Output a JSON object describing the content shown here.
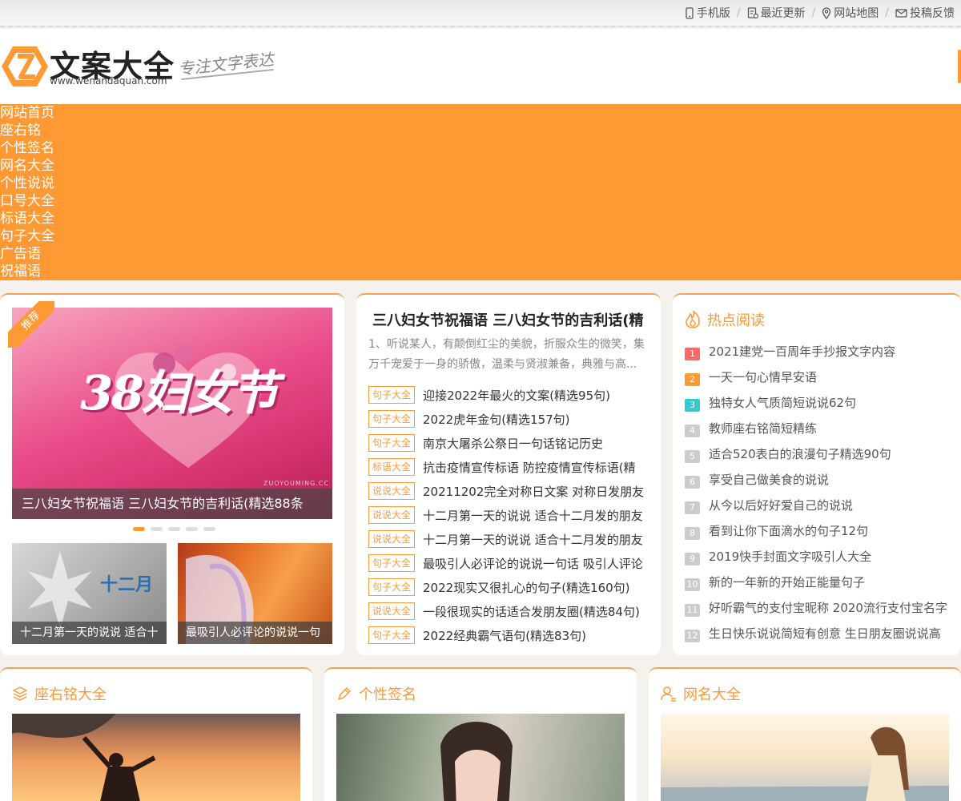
{
  "topbar": {
    "links": [
      {
        "label": "手机版",
        "icon": "mobile-icon"
      },
      {
        "label": "最近更新",
        "icon": "update-icon"
      },
      {
        "label": "网站地图",
        "icon": "map-pin-icon"
      },
      {
        "label": "投稿反馈",
        "icon": "mail-icon"
      }
    ]
  },
  "header": {
    "logo_title": "文案大全",
    "logo_url": "www.wenandaquan.com",
    "slogan": "专注文字表达"
  },
  "nav": {
    "items": [
      "网站首页",
      "座右铭",
      "个性签名",
      "网名大全",
      "个性说说",
      "口号大全",
      "标语大全",
      "句子大全",
      "广告语",
      "祝福语"
    ]
  },
  "slider": {
    "badge": "推荐",
    "caption": "三八妇女节祝福语 三八妇女节的吉利话(精选88条",
    "image_text": "38妇女节",
    "watermark": "ZUOYOUMING.CC",
    "thumbs": [
      {
        "caption": "十二月第一天的说说 适合十",
        "image_text": "十二月"
      },
      {
        "caption": "最吸引人必评论的说说一句"
      }
    ]
  },
  "middle": {
    "title": "三八妇女节祝福语 三八妇女节的吉利话(精",
    "desc": "1、听说某人，有颠倒红尘的美貌，折服众生的微笑，集万千宠爱于一身的骄傲，温柔与贤淑兼备，典雅与高...",
    "items": [
      {
        "tag": "句子大全",
        "title": "迎接2022年最火的文案(精选95句)"
      },
      {
        "tag": "句子大全",
        "title": "2022虎年金句(精选157句)"
      },
      {
        "tag": "句子大全",
        "title": "南京大屠杀公祭日一句话铭记历史"
      },
      {
        "tag": "标语大全",
        "title": "抗击疫情宣传标语 防控疫情宣传标语(精"
      },
      {
        "tag": "说说大全",
        "title": "20211202完全对称日文案 对称日发朋友"
      },
      {
        "tag": "说说大全",
        "title": "十二月第一天的说说 适合十二月发的朋友"
      },
      {
        "tag": "说说大全",
        "title": "十二月第一天的说说 适合十二月发的朋友"
      },
      {
        "tag": "句子大全",
        "title": "最吸引人必评论的说说一句话 吸引人评论"
      },
      {
        "tag": "句子大全",
        "title": "2022现实又很扎心的句子(精选160句)"
      },
      {
        "tag": "说说大全",
        "title": "一段很现实的话适合发朋友圈(精选84句)"
      },
      {
        "tag": "句子大全",
        "title": "2022经典霸气语句(精选83句)"
      }
    ]
  },
  "hot": {
    "title": "热点阅读",
    "icon": "fire-icon",
    "items": [
      {
        "num": "1",
        "title": "2021建党一百周年手抄报文字内容"
      },
      {
        "num": "2",
        "title": "一天一句心情早安语"
      },
      {
        "num": "3",
        "title": "独特女人气质简短说说62句"
      },
      {
        "num": "4",
        "title": "教师座右铭简短精练"
      },
      {
        "num": "5",
        "title": "适合520表白的浪漫句子精选90句"
      },
      {
        "num": "6",
        "title": "享受自己做美食的说说"
      },
      {
        "num": "7",
        "title": "从今以后好好爱自己的说说"
      },
      {
        "num": "8",
        "title": "看到让你下面滴水的句子12句"
      },
      {
        "num": "9",
        "title": "2019快手封面文字吸引人大全"
      },
      {
        "num": "10",
        "title": "新的一年新的开始正能量句子"
      },
      {
        "num": "11",
        "title": "好听霸气的支付宝昵称 2020流行支付宝名字"
      },
      {
        "num": "12",
        "title": "生日快乐说说简短有创意 生日朋友圈说说高"
      }
    ]
  },
  "sections": [
    {
      "title": "座右铭大全",
      "icon": "layers-icon"
    },
    {
      "title": "个性签名",
      "icon": "pen-icon"
    },
    {
      "title": "网名大全",
      "icon": "user-icon"
    }
  ],
  "colors": {
    "accent": "#ff9933",
    "rank1": "#ff6666",
    "rank3": "#33cccc"
  }
}
